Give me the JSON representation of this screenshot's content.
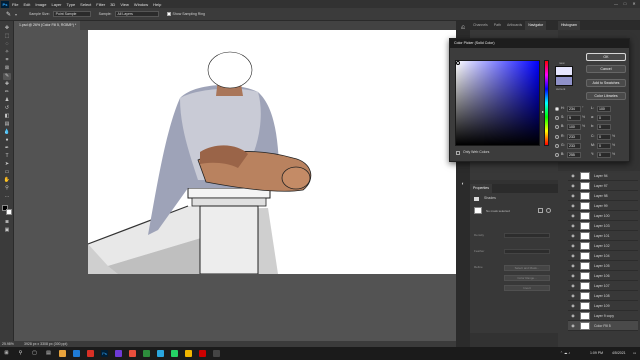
{
  "menubar": {
    "app_logo": "Ps",
    "items": [
      "File",
      "Edit",
      "Image",
      "Layer",
      "Type",
      "Select",
      "Filter",
      "3D",
      "View",
      "Window",
      "Help"
    ]
  },
  "options": {
    "sample_size_label": "Sample Size:",
    "sample_size_value": "Point Sample",
    "sample_label": "Sample:",
    "sample_value": "All Layers",
    "show_ring_label": "Show Sampling Ring"
  },
  "document": {
    "tab_title": "1.psd @ 26% (Color Fill 5, RGB/8*) *"
  },
  "status": {
    "zoom": "25.98%",
    "doc_info": "3928 px x 3308 px (300 ppi)"
  },
  "panels": {
    "top_tabs": [
      "Channels",
      "Path",
      "Artboards",
      "Navigator"
    ],
    "histogram_tab": "Histogram",
    "properties_tab": "Properties",
    "properties_type": "Shades",
    "properties_link": "No mask selected",
    "prop_density": "Density",
    "prop_feather": "Feather",
    "prop_refine": "Refine",
    "prop_select_mask": "Select and Mask...",
    "prop_color_range": "Color Range...",
    "prop_invert": "Invert"
  },
  "layers": [
    {
      "name": "Layer 94"
    },
    {
      "name": "Layer 97"
    },
    {
      "name": "Layer 98"
    },
    {
      "name": "Layer 99"
    },
    {
      "name": "Layer 100"
    },
    {
      "name": "Layer 103"
    },
    {
      "name": "Layer 101"
    },
    {
      "name": "Layer 102"
    },
    {
      "name": "Layer 104"
    },
    {
      "name": "Layer 105"
    },
    {
      "name": "Layer 106"
    },
    {
      "name": "Layer 107"
    },
    {
      "name": "Layer 108"
    },
    {
      "name": "Layer 109"
    },
    {
      "name": "Layer 9 copy"
    },
    {
      "name": "Color Fill 5",
      "selected": true
    }
  ],
  "color_picker": {
    "title": "Color Picker (Solid Color)",
    "ok": "OK",
    "cancel": "Cancel",
    "add_swatches": "Add to Swatches",
    "color_libraries": "Color Libraries",
    "new_label": "new",
    "current_label": "current",
    "only_web_colors": "Only Web Colors",
    "new_color": "#e6e6ff",
    "current_color": "#8f91c9",
    "fields": {
      "H": "234",
      "S": "9",
      "B": "100",
      "R": "233",
      "G": "233",
      "Bv": "255",
      "L": "100",
      "a": "0",
      "b": "0",
      "C": "0",
      "M": "0",
      "Y": "0",
      "K": "0",
      "hex": "e9e9ff"
    },
    "units": {
      "deg": "°",
      "pct": "%"
    }
  },
  "taskbar": {
    "time": "1:09 PM",
    "date": "4/5/2021"
  },
  "colors": {
    "accent": "#1473e6",
    "ps_blue": "#31a8ff"
  }
}
